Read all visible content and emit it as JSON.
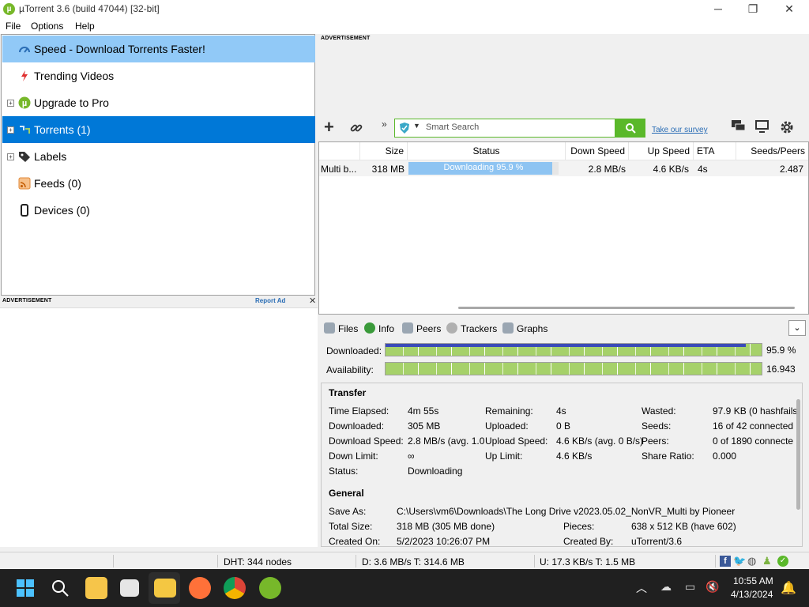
{
  "window": {
    "title": "µTorrent 3.6  (build 47044) [32-bit]",
    "controls": [
      "minimize-icon",
      "restore-icon",
      "close-icon"
    ]
  },
  "menu": [
    "File",
    "Options",
    "Help"
  ],
  "sidebar": {
    "items": [
      {
        "label": "Speed - Download Torrents Faster!",
        "icon": "speedometer-icon"
      },
      {
        "label": "Trending Videos",
        "icon": "lightning-icon"
      },
      {
        "label": "Upgrade to Pro",
        "icon": "utorrent-logo-icon"
      },
      {
        "label": "Torrents (1)",
        "icon": "torrents-icon"
      },
      {
        "label": "Labels",
        "icon": "tag-icon"
      },
      {
        "label": "Feeds (0)",
        "icon": "rss-icon"
      },
      {
        "label": "Devices (0)",
        "icon": "device-icon"
      }
    ]
  },
  "ads": {
    "top_label": "ADVERTISEMENT",
    "left_label": "ADVERTISEMENT",
    "report": "Report Ad"
  },
  "search": {
    "placeholder": "Smart Search",
    "survey": "Take our survey"
  },
  "list": {
    "columns": [
      "Size",
      "Status",
      "Down Speed",
      "Up Speed",
      "ETA",
      "Seeds/Peers"
    ],
    "rows": [
      {
        "name": "Multi b...",
        "size": "318 MB",
        "status": "Downloading 95.9 %",
        "progress": 0.959,
        "down": "2.8 MB/s",
        "up": "4.6 KB/s",
        "eta": "4s",
        "seeds": "2.487"
      }
    ]
  },
  "tabs": [
    "Files",
    "Info",
    "Peers",
    "Trackers",
    "Graphs"
  ],
  "bars": {
    "downloaded_label": "Downloaded:",
    "downloaded_value": "95.9 %",
    "availability_label": "Availability:",
    "availability_value": "16.943"
  },
  "transfer": {
    "title": "Transfer",
    "time_elapsed": [
      "Time Elapsed:",
      "4m 55s"
    ],
    "remaining": [
      "Remaining:",
      "4s"
    ],
    "wasted": [
      "Wasted:",
      "97.9 KB (0 hashfails"
    ],
    "downloaded": [
      "Downloaded:",
      "305 MB"
    ],
    "uploaded": [
      "Uploaded:",
      "0 B"
    ],
    "seeds": [
      "Seeds:",
      "16 of 42 connected"
    ],
    "download_speed": [
      "Download Speed:",
      "2.8 MB/s (avg. 1.0"
    ],
    "upload_speed": [
      "Upload Speed:",
      "4.6 KB/s (avg. 0 B/s)"
    ],
    "peers": [
      "Peers:",
      "0 of 1890 connecte"
    ],
    "down_limit": [
      "Down Limit:",
      "∞"
    ],
    "up_limit": [
      "Up Limit:",
      "4.6 KB/s"
    ],
    "share_ratio": [
      "Share Ratio:",
      "0.000"
    ],
    "status": [
      "Status:",
      "Downloading"
    ]
  },
  "general": {
    "title": "General",
    "save_as": [
      "Save As:",
      "C:\\Users\\vm6\\Downloads\\The Long Drive v2023.05.02_NonVR_Multi by Pioneer"
    ],
    "total_size": [
      "Total Size:",
      "318 MB (305 MB done)"
    ],
    "pieces": [
      "Pieces:",
      "638 x 512 KB (have 602)"
    ],
    "created_on": [
      "Created On:",
      "5/2/2023 10:26:07 PM"
    ],
    "created_by": [
      "Created By:",
      "uTorrent/3.6"
    ]
  },
  "statusbar": {
    "dht": "DHT: 344 nodes",
    "down": "D: 3.6 MB/s T: 314.6 MB",
    "up": "U: 17.3 KB/s T: 1.5 MB"
  },
  "taskbar": {
    "time": "10:55 AM",
    "date": "4/13/2024"
  }
}
